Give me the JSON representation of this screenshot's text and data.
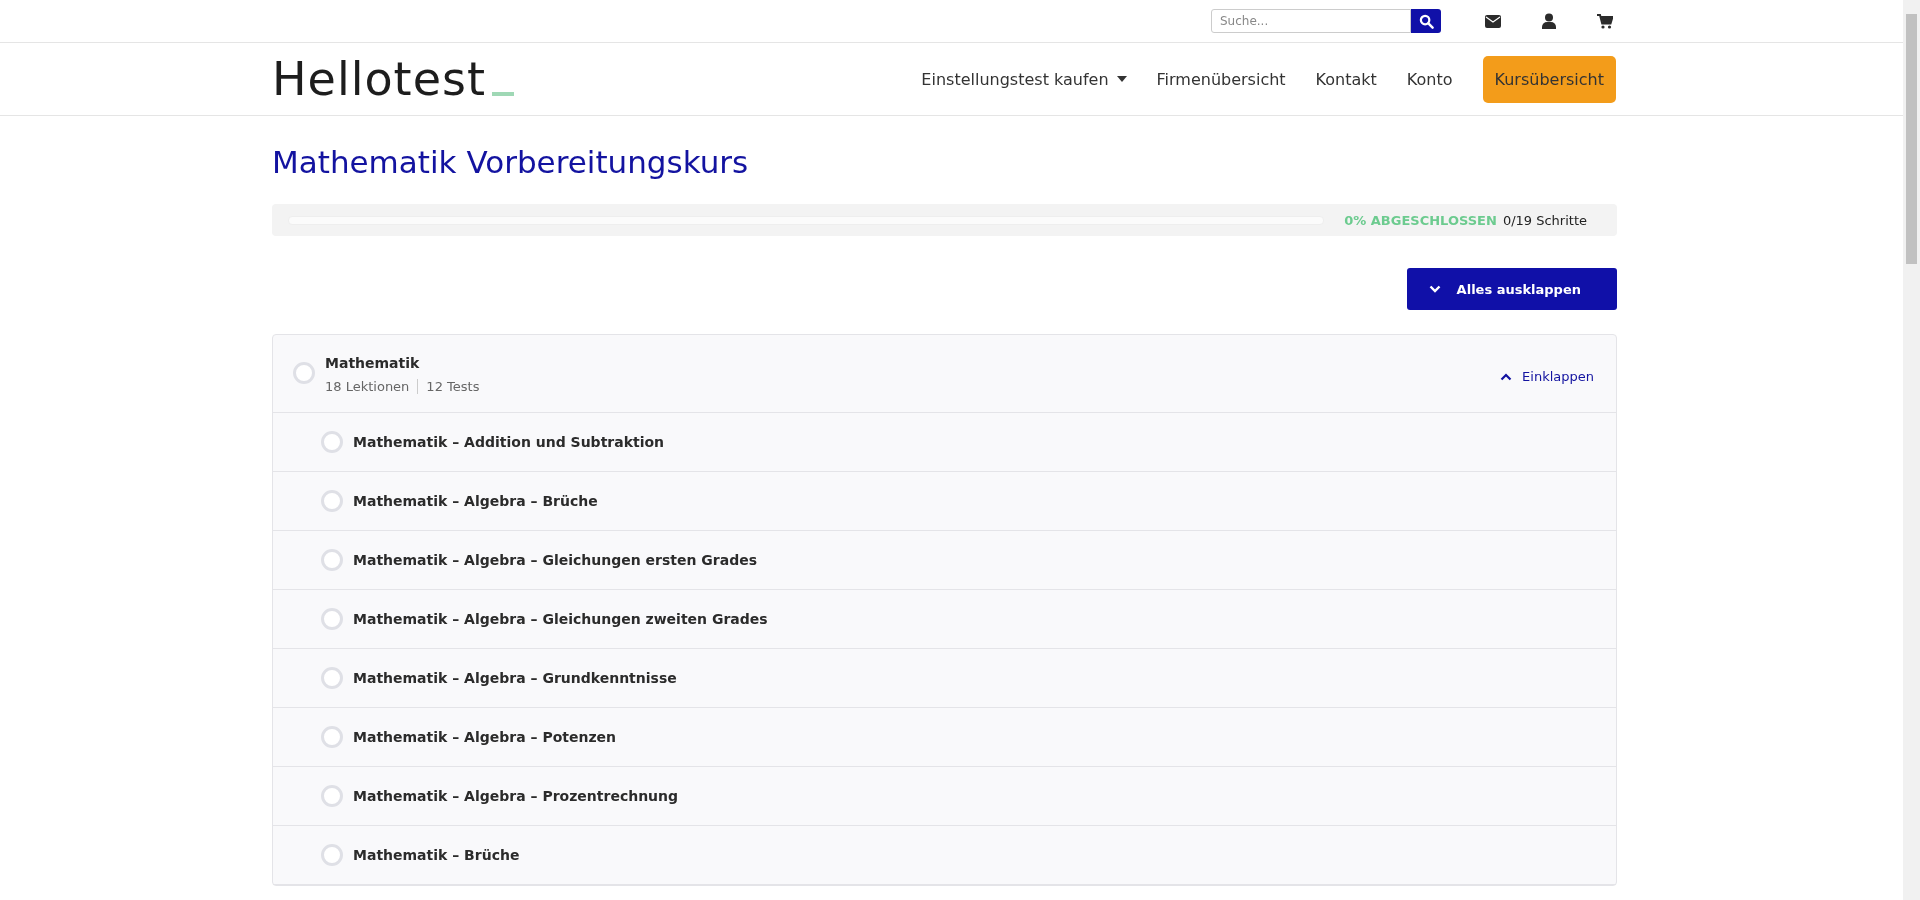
{
  "top_bar": {
    "search": {
      "placeholder": "Suche..."
    }
  },
  "header": {
    "logo": {
      "text": "Hellotest"
    },
    "nav": [
      {
        "label": "Einstellungstest kaufen",
        "dropdown": true,
        "kind": "link"
      },
      {
        "label": "Firmenübersicht",
        "dropdown": false,
        "kind": "link"
      },
      {
        "label": "Kontakt",
        "dropdown": false,
        "kind": "link"
      },
      {
        "label": "Konto",
        "dropdown": false,
        "kind": "link"
      },
      {
        "label": "Kursübersicht",
        "dropdown": false,
        "kind": "button"
      }
    ]
  },
  "course": {
    "title": "Mathematik Vorbereitungskurs",
    "progress": {
      "level": 0,
      "percent": "0% ABGESCHLOSSEN",
      "steps": "0/19 Schritte"
    },
    "expand_all": "Alles ausklappen",
    "section": {
      "title": "Mathematik",
      "completed": false,
      "lessons_count": "18 Lektionen",
      "tests_count": "12 Tests",
      "toggle": "Einklappen",
      "expanded": true,
      "lessons": [
        {
          "title": "Mathematik – Addition und Subtraktion",
          "completed": false
        },
        {
          "title": "Mathematik – Algebra – Brüche",
          "completed": false
        },
        {
          "title": "Mathematik – Algebra – Gleichungen ersten Grades",
          "completed": false
        },
        {
          "title": "Mathematik – Algebra – Gleichungen zweiten Grades",
          "completed": false
        },
        {
          "title": "Mathematik – Algebra – Grundkenntnisse",
          "completed": false
        },
        {
          "title": "Mathematik – Algebra – Potenzen",
          "completed": false
        },
        {
          "title": "Mathematik – Algebra – Prozentrechnung",
          "completed": false
        },
        {
          "title": "Mathematik – Brüche",
          "completed": false
        }
      ]
    }
  }
}
